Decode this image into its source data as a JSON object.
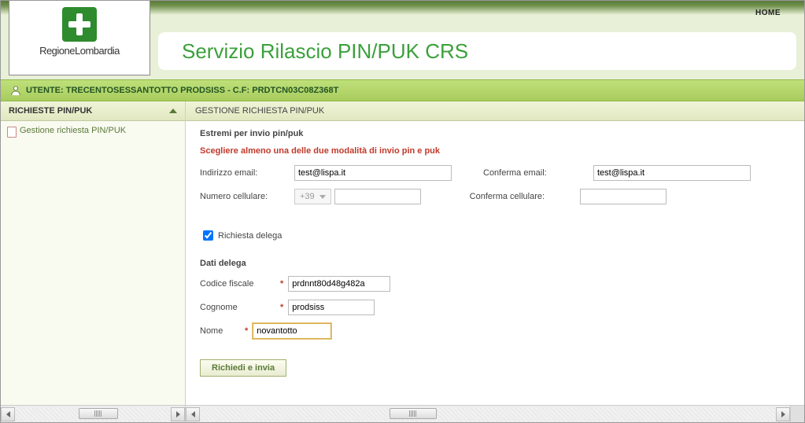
{
  "header": {
    "home": "HOME",
    "logo_text": "RegioneLombardia",
    "title": "Servizio Rilascio PIN/PUK CRS"
  },
  "userbar": {
    "text": "UTENTE: TRECENTOSESSANTOTTO PRODSISS  - C.F: PRDTCN03C08Z368T"
  },
  "sidebar": {
    "head": "RICHIESTE PIN/PUK",
    "item": "Gestione richiesta PIN/PUK"
  },
  "main": {
    "head": "GESTIONE RICHIESTA PIN/PUK",
    "estremi": "Estremi per invio pin/puk",
    "warning": "Scegliere almeno una delle due modalità di invio pin e puk",
    "labels": {
      "email": "Indirizzo email:",
      "email_conf": "Conferma email:",
      "cell": "Numero cellulare:",
      "cell_conf": "Conferma cellulare:",
      "prefix": "+39",
      "delega_check": "Richiesta delega",
      "dati_delega": "Dati delega",
      "cf": "Codice fiscale",
      "cognome": "Cognome",
      "nome": "Nome",
      "req": "*"
    },
    "values": {
      "email": "test@lispa.it",
      "email_conf": "test@lispa.it",
      "cell": "",
      "cell_conf": "",
      "cf": "prdnnt80d48g482a",
      "cognome": "prodsiss",
      "nome": "novantotto"
    },
    "submit": "Richiedi e invia"
  }
}
